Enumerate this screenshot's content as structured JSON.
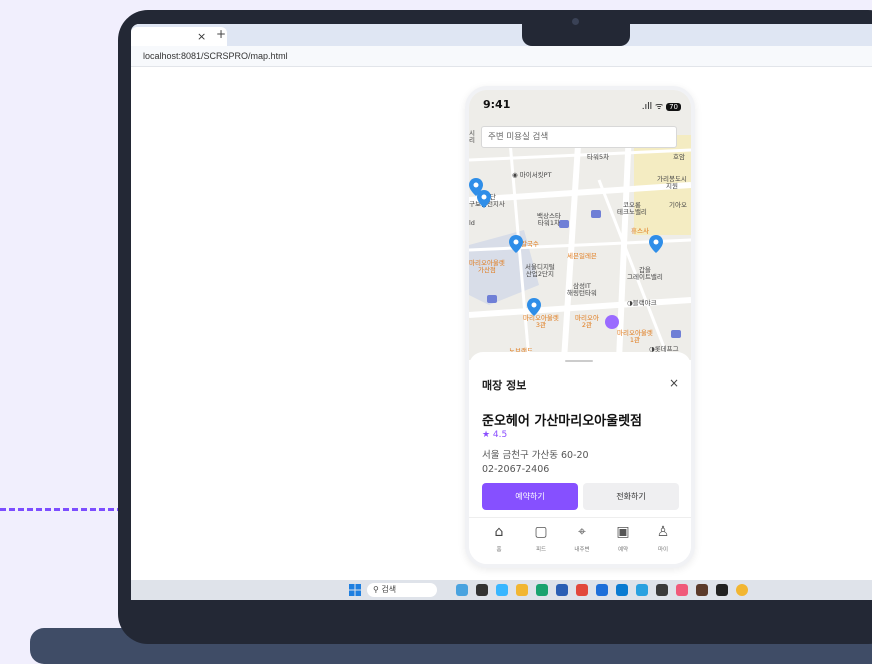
{
  "browser": {
    "tab_close": "×",
    "tab_new": "+",
    "url": "localhost:8081/SCRSPRO/map.html"
  },
  "phone": {
    "status_time": "9:41",
    "status_signal": ".ıll ᯤ",
    "battery": "70"
  },
  "search": {
    "placeholder": "주변 미용실 검색"
  },
  "map_labels": {
    "top_left": "시\n리",
    "tower5": "타워5차",
    "hoam": "호암",
    "mysitpt": "◉ 마이서킷PT",
    "garibong": "가리봉도시\n지원",
    "gongdan": "국공단\n구보금천지사",
    "gio": "기아오",
    "baeksang": "백상스타\n타워1차",
    "korong": "코오롱\n테크노밸리",
    "hyususa": "휴스사",
    "id": "ld",
    "myeongdong": "명동칼국수",
    "sebeneleven": "세븐일레븐",
    "marioset": "마리오아울렛\n가산점",
    "seouldigital": "서울디지털\n산업2단지",
    "gatel": "갑을\n그레이트밸리",
    "samsung": "삼성IT\n해링턴타워",
    "blackyak": "◑블랙야크",
    "mario3": "마리오아울렛\n3관",
    "mario2": "마리오아\n2관",
    "mario1": "마리오아울렛\n1관",
    "nohuche": "노브랜드",
    "lotte": "◑롯데프그"
  },
  "sheet": {
    "title": "매장 정보",
    "close": "×",
    "store_name": "준오헤어 가산마리오아울렛점",
    "rating": "★ 4.5",
    "address": "서울 금천구 가산동 60-20",
    "phone": "02-2067-2406",
    "reserve_label": "예약하기",
    "call_label": "전화하기"
  },
  "nav": [
    {
      "label": "홈",
      "icon": "home-icon"
    },
    {
      "label": "피드",
      "icon": "feed-icon"
    },
    {
      "label": "내주변",
      "icon": "map-pin-icon"
    },
    {
      "label": "예약",
      "icon": "calendar-icon"
    },
    {
      "label": "마이",
      "icon": "user-icon"
    }
  ],
  "taskbar": {
    "search_label": "검색"
  },
  "colors": {
    "accent": "#8650ff",
    "pin": "#2f8ee8",
    "cluster": "#9a6bff",
    "background": "#f1effd"
  }
}
